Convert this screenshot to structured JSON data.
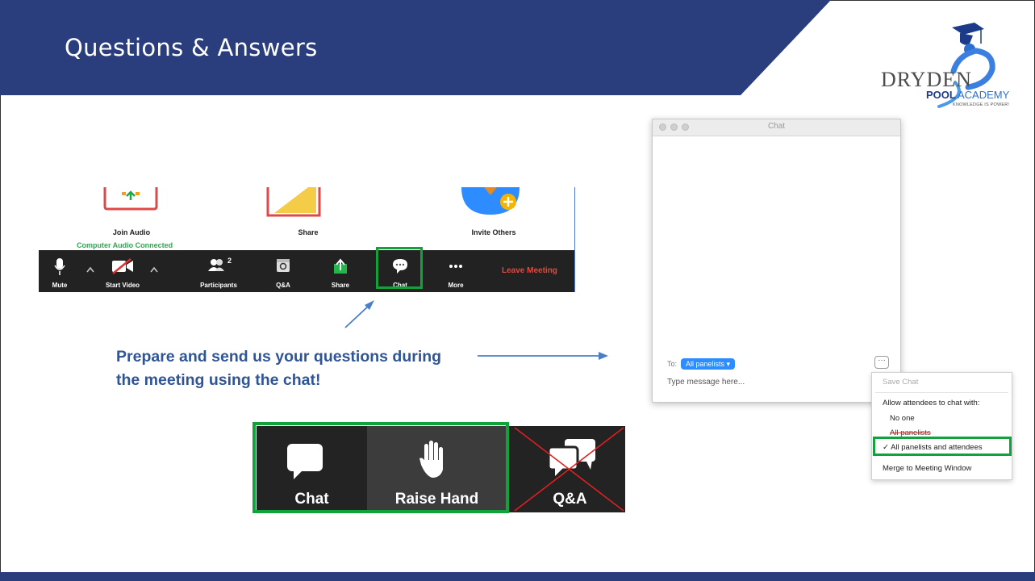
{
  "slide": {
    "title": "Questions & Answers",
    "callout": "Prepare and send us your questions during the meeting using the chat!",
    "colors": {
      "header": "#2a3d7c",
      "highlight": "#11a23c",
      "callout": "#2f5597"
    }
  },
  "logo": {
    "name": "DRYDEN",
    "pool": "POOL",
    "academy": "ACADEMY",
    "tagline": "KNOWLEDGE IS POWER!"
  },
  "zoom_window": {
    "tiles": [
      {
        "label": "Join Audio",
        "status": "Computer Audio Connected",
        "icon": "headphones-arrow-icon"
      },
      {
        "label": "Share",
        "icon": "share-screen-icon"
      },
      {
        "label": "Invite Others",
        "icon": "invite-others-icon"
      }
    ],
    "toolbar": [
      {
        "label": "Mute",
        "icon": "microphone-icon"
      },
      {
        "label": "Start Video",
        "icon": "video-off-icon"
      },
      {
        "label": "Participants",
        "icon": "participants-icon",
        "badge": "2"
      },
      {
        "label": "Q&A",
        "icon": "qa-icon"
      },
      {
        "label": "Share",
        "icon": "share-icon"
      },
      {
        "label": "Chat",
        "icon": "chat-icon"
      },
      {
        "label": "More",
        "icon": "more-icon"
      }
    ],
    "leave": "Leave Meeting"
  },
  "chat_window": {
    "title": "Chat",
    "to_label": "To:",
    "recipient": "All panelists ▾",
    "placeholder": "Type message here...",
    "more": "···"
  },
  "chat_menu": {
    "save": "Save Chat",
    "allow": "Allow attendees to chat with:",
    "none": "No one",
    "panelists": "All panelists",
    "all": "✓ All panelists and attendees",
    "merge": "Merge to Meeting Window"
  },
  "big_buttons": {
    "chat": "Chat",
    "raise": "Raise Hand",
    "qa": "Q&A"
  }
}
